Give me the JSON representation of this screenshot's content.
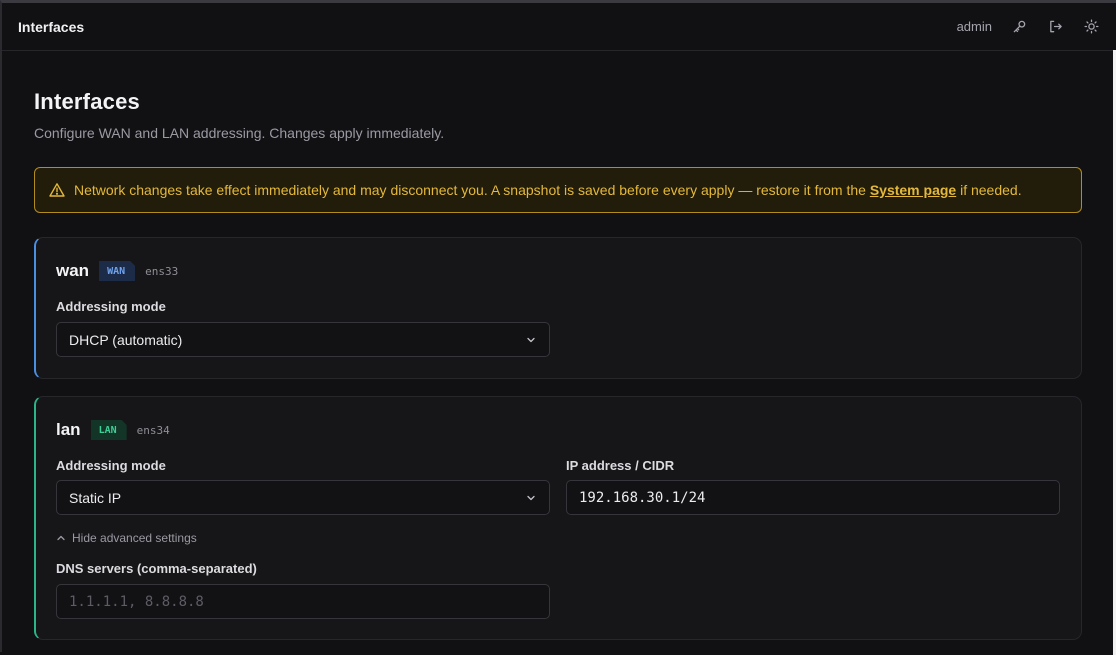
{
  "topbar": {
    "title": "Interfaces",
    "user": "admin",
    "icons": [
      "key-icon",
      "logout-icon",
      "theme-sun-icon"
    ]
  },
  "page": {
    "title": "Interfaces",
    "subtitle": "Configure WAN and LAN addressing. Changes apply immediately."
  },
  "warning": {
    "text_before": "Network changes take effect immediately and may disconnect you. A snapshot is saved before every apply — restore it from the",
    "link": "System page",
    "text_after": "if needed."
  },
  "interfaces": {
    "wan": {
      "name": "wan",
      "tag": "WAN",
      "device": "ens33",
      "mode_label": "Addressing mode",
      "mode_value": "DHCP (automatic)",
      "accent": "#4a90e2"
    },
    "lan": {
      "name": "lan",
      "tag": "LAN",
      "device": "ens34",
      "mode_label": "Addressing mode",
      "mode_value": "Static IP",
      "ip_label": "IP address / CIDR",
      "ip_value": "192.168.30.1/24",
      "advanced_toggle": "Hide advanced settings",
      "dns_label": "DNS servers (comma-separated)",
      "dns_placeholder": "1.1.1.1, 8.8.8.8",
      "accent": "#2bb58a"
    }
  },
  "colors": {
    "background": "#111114",
    "warning": "#e4b83a"
  }
}
